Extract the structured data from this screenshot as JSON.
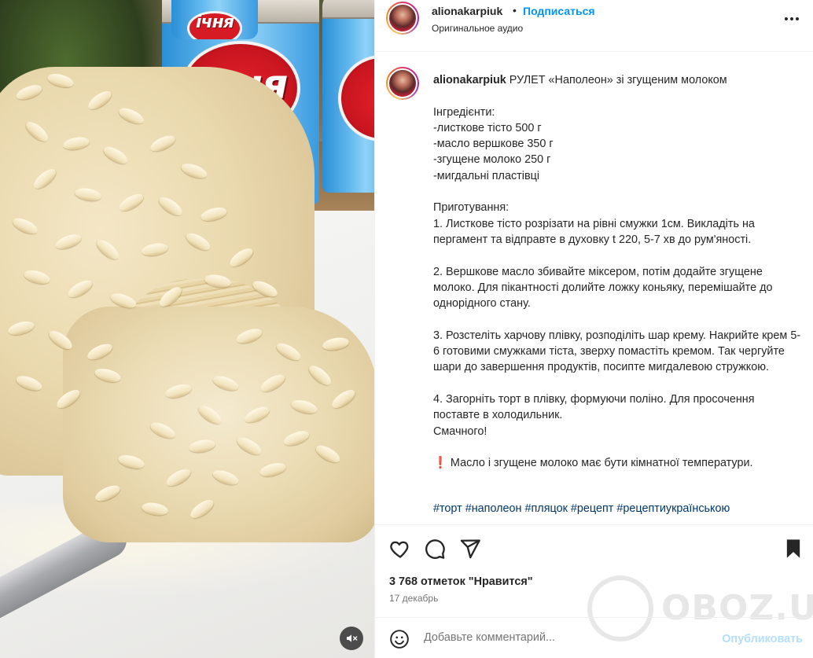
{
  "post": {
    "username": "alionakarpiuk",
    "separator": "•",
    "follow_label": "Подписаться",
    "audio_label": "Оригинальное аудио",
    "more_icon": "more-horizontal-icon"
  },
  "media": {
    "can_brand": "ічня",
    "mute_icon": "speaker-muted-icon"
  },
  "caption": {
    "username": "alionakarpiuk",
    "title": "РУЛЕТ «Наполеон» зі згущеним молоком",
    "body_lines": [
      "",
      "Інгредієнти:",
      "-листкове тісто 500 г",
      "-масло вершкове 350 г",
      "-згущене молоко 250 г",
      "-мигдальні пластівці",
      "",
      "Приготування:",
      "1. Листкове тісто розрізати на рівні смужки 1см. Викладіть на пергамент та відправте в духовку t 220, 5-7 хв до рум'яності.",
      "",
      "2. Вершкове масло збивайте міксером, потім додайте згущене молоко. Для пікантності долийте ложку коньяку, перемішайте до однорідного стану.",
      "",
      "3. Розстеліть харчову плівку, розподіліть шар крему. Накрийте крем 5-6 готовими смужками тіста, зверху помастіть кремом. Так чергуйте шари до завершення продуктів, посипте мигдалевою стружкою.",
      "",
      "4. Загорніть торт в плівку, формуючи поліно. Для просочення поставте в холодильник.",
      "Смачного!",
      ""
    ],
    "warning_icon": "❗",
    "warning_text": "Масло і згущене молоко має бути кімнатної температури.",
    "hashtags": [
      "#торт",
      "#наполеон",
      "#пляцок",
      "#рецепт",
      "#рецептиукраїнською"
    ]
  },
  "actions": {
    "like_icon": "heart-icon",
    "comment_icon": "comment-icon",
    "share_icon": "paper-plane-icon",
    "save_icon": "bookmark-icon",
    "likes_text": "3 768 отметок \"Нравится\"",
    "date": "17 декабрь"
  },
  "watermark": {
    "text": "OBOZ.UA"
  },
  "comment": {
    "emoji_icon": "smiley-icon",
    "placeholder": "Добавьте комментарий...",
    "post_label": "Опубликовать"
  },
  "colors": {
    "accent": "#0095f6",
    "link": "#00376b",
    "text": "#262626",
    "muted": "#737373",
    "post_disabled": "#b2dffc"
  }
}
